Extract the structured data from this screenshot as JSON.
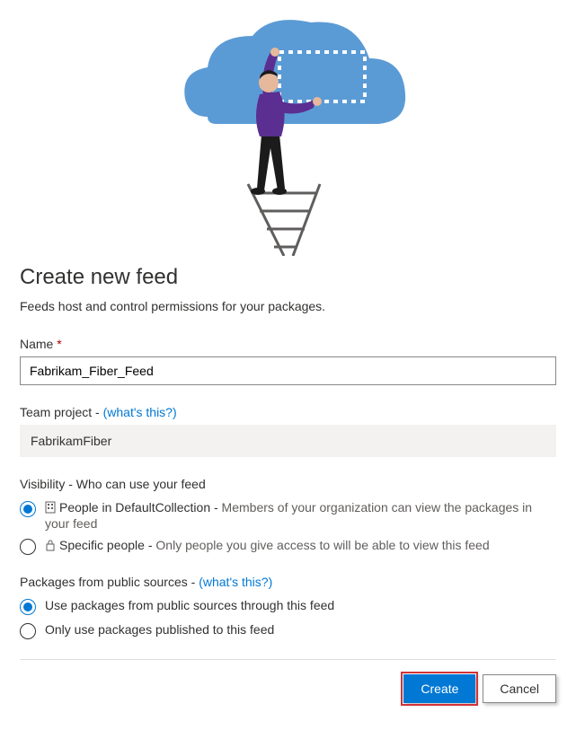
{
  "title": "Create new feed",
  "subtitle": "Feeds host and control permissions for your packages.",
  "name": {
    "label": "Name",
    "required_mark": "*",
    "value": "Fabrikam_Fiber_Feed"
  },
  "team_project": {
    "label": "Team project - ",
    "help_link": "(what's this?)",
    "value": "FabrikamFiber"
  },
  "visibility": {
    "label": "Visibility - Who can use your feed",
    "options": [
      {
        "title": "People in DefaultCollection - ",
        "desc": "Members of your organization can view the packages in your feed",
        "checked": true,
        "icon": "organization-icon"
      },
      {
        "title": "Specific people - ",
        "desc": "Only people you give access to will be able to view this feed",
        "checked": false,
        "icon": "lock-icon"
      }
    ]
  },
  "public_sources": {
    "label_prefix": "Packages from public sources - ",
    "help_link": "(what's this?)",
    "options": [
      {
        "label": "Use packages from public sources through this feed",
        "checked": true
      },
      {
        "label": "Only use packages published to this feed",
        "checked": false
      }
    ]
  },
  "buttons": {
    "create": "Create",
    "cancel": "Cancel"
  }
}
